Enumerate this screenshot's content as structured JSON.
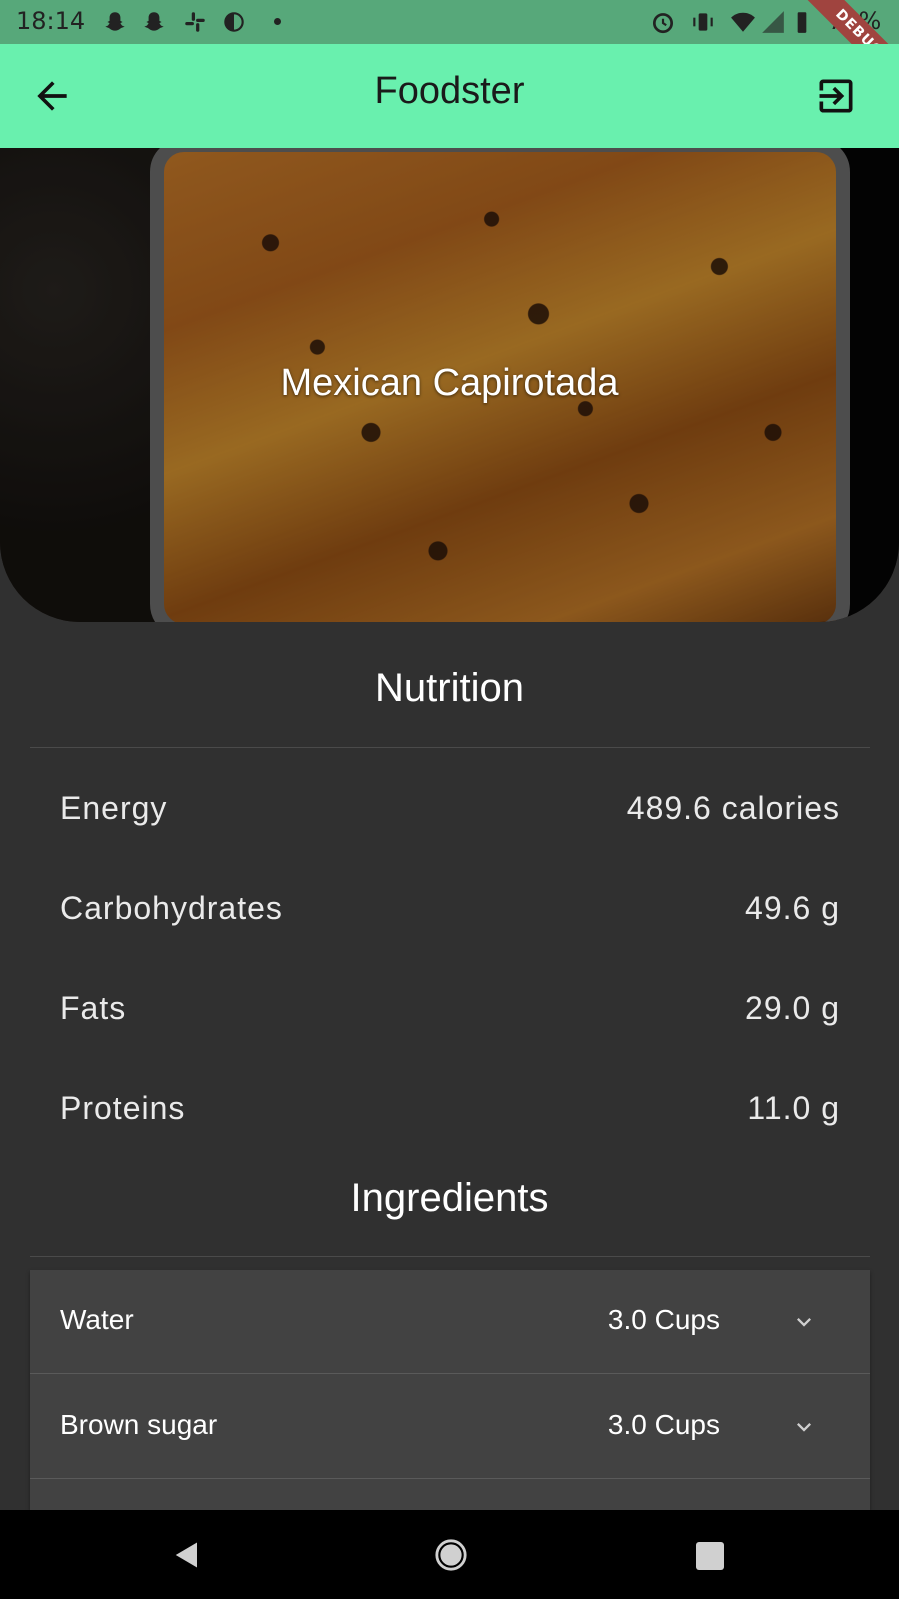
{
  "status_bar": {
    "time": "18:14",
    "battery": "71%",
    "debug_label": "DEBUG",
    "icons": [
      "snapchat-icon",
      "snapchat-icon",
      "slack-icon",
      "circle-half-icon",
      "alarm-icon",
      "vibrate-icon",
      "wifi-icon",
      "signal-icon",
      "battery-icon"
    ]
  },
  "app_bar": {
    "title": "Foodster",
    "back_icon": "arrow-back-icon",
    "logout_icon": "exit-icon",
    "color": "#69f0ae"
  },
  "recipe": {
    "title": "Mexican Capirotada"
  },
  "nutrition": {
    "heading": "Nutrition",
    "rows": [
      {
        "label": "Energy",
        "value": "489.6 calories"
      },
      {
        "label": "Carbohydrates",
        "value": "49.6 g"
      },
      {
        "label": "Fats",
        "value": "29.0 g"
      },
      {
        "label": "Proteins",
        "value": "11.0 g"
      }
    ]
  },
  "ingredients": {
    "heading": "Ingredients",
    "items": [
      {
        "name": "Water",
        "qty": "3.0 Cups"
      },
      {
        "name": "Brown sugar",
        "qty": "3.0 Cups"
      }
    ]
  },
  "colors": {
    "background": "#303030",
    "card": "#424242",
    "status_bar": "#57a87a"
  }
}
